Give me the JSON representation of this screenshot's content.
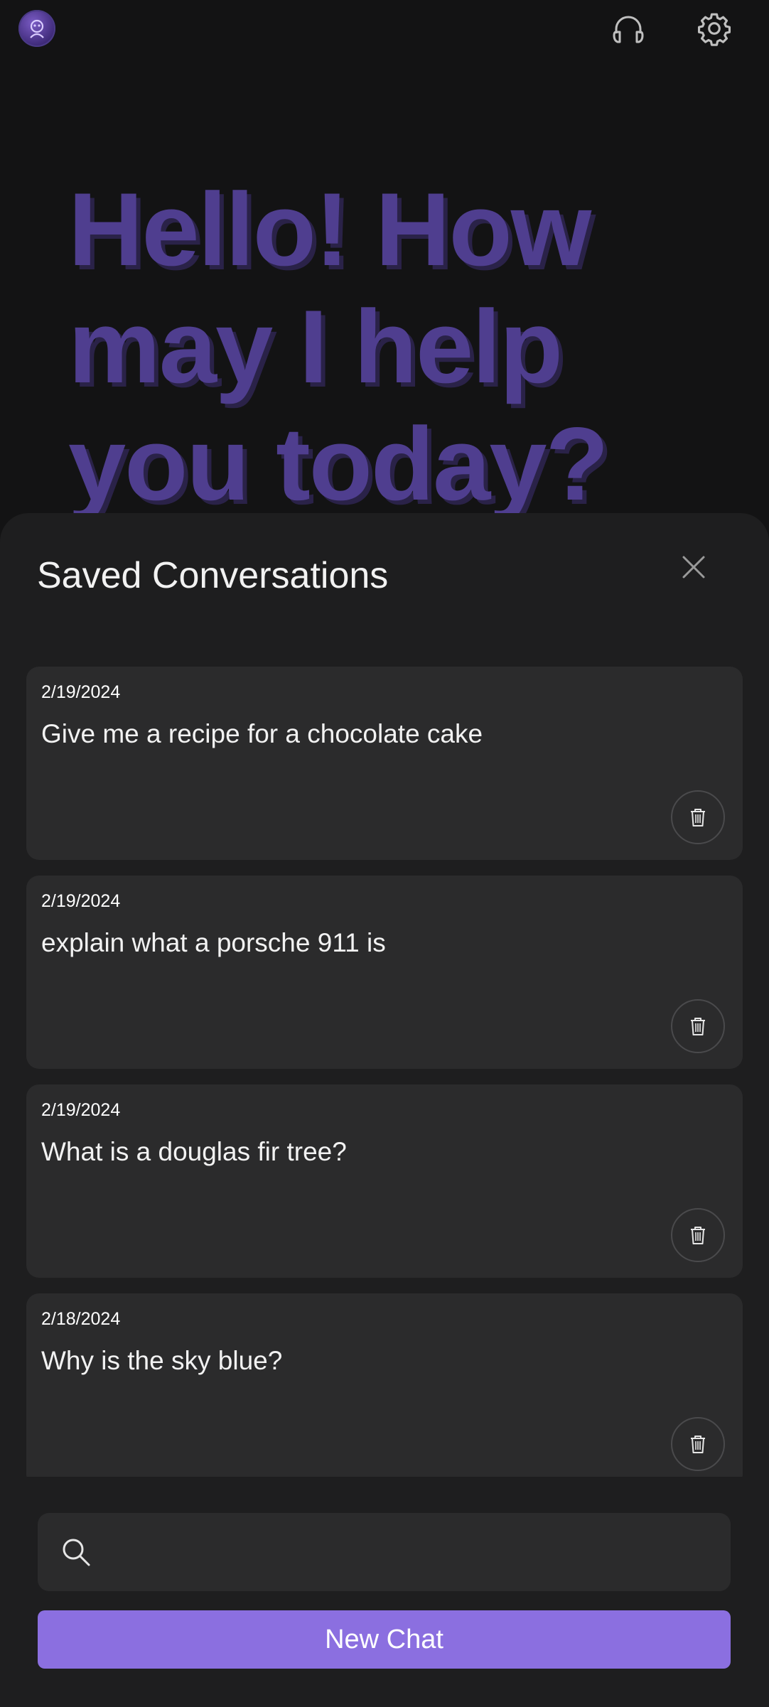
{
  "app": {
    "accent_color": "#8b6fe0",
    "greeting_color": "#4f3e8f",
    "background_color": "#131314",
    "sheet_color": "#1e1e1f"
  },
  "topbar": {
    "avatar_icon": "assistant-avatar-icon",
    "headphones_icon": "headphones-icon",
    "settings_icon": "gear-icon"
  },
  "greeting": {
    "text": "Hello! How may I help you today?"
  },
  "sheet": {
    "title": "Saved Conversations",
    "close_icon": "close-icon",
    "conversations": [
      {
        "date": "2/19/2024",
        "text": "Give me a recipe for a chocolate cake"
      },
      {
        "date": "2/19/2024",
        "text": "explain what a porsche 911 is"
      },
      {
        "date": "2/19/2024",
        "text": "What is a douglas fir tree?"
      },
      {
        "date": "2/18/2024",
        "text": "Why is the sky blue?"
      }
    ],
    "delete_icon": "trash-icon"
  },
  "search": {
    "icon": "search-icon",
    "value": "",
    "placeholder": ""
  },
  "new_chat": {
    "label": "New Chat"
  }
}
